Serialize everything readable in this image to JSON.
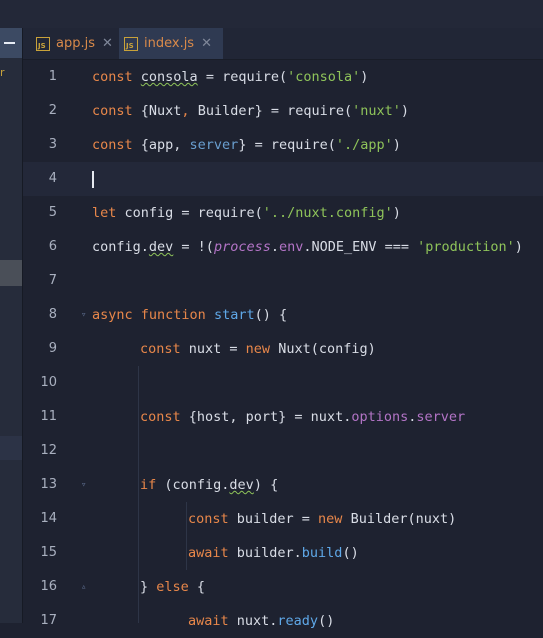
{
  "tabs": [
    {
      "label": "app.js",
      "icon": "js-file-icon",
      "active": false
    },
    {
      "label": "index.js",
      "icon": "js-file-icon",
      "active": true
    }
  ],
  "tab_close_glyph": "✕",
  "sidebar": {
    "letter": "r"
  },
  "editor": {
    "current_line": 4,
    "lines": [
      {
        "n": "1"
      },
      {
        "n": "2"
      },
      {
        "n": "3"
      },
      {
        "n": "4"
      },
      {
        "n": "5"
      },
      {
        "n": "6"
      },
      {
        "n": "7"
      },
      {
        "n": "8"
      },
      {
        "n": "9"
      },
      {
        "n": "10"
      },
      {
        "n": "11"
      },
      {
        "n": "12"
      },
      {
        "n": "13"
      },
      {
        "n": "14"
      },
      {
        "n": "15"
      },
      {
        "n": "16"
      },
      {
        "n": "17"
      }
    ],
    "tokens": {
      "l1": [
        "const",
        " ",
        "consola",
        " = ",
        "require",
        "(",
        "'consola'",
        ")"
      ],
      "l2": [
        "const",
        " {Nuxt",
        ", ",
        "Builder} = ",
        "require",
        "(",
        "'nuxt'",
        ")"
      ],
      "l3": [
        "const",
        " {app, ",
        "server",
        "} = ",
        "require",
        "(",
        "'./app'",
        ")"
      ],
      "l5": [
        "let",
        " config = ",
        "require",
        "(",
        "'../nuxt.config'",
        ")"
      ],
      "l6": [
        "config.",
        "dev",
        " = !(",
        "process",
        ".",
        "env",
        ".NODE_ENV === ",
        "'production'",
        ")"
      ],
      "l8": [
        "async",
        " ",
        "function",
        " ",
        "start",
        "() {"
      ],
      "l9": [
        "const",
        " nuxt = ",
        "new",
        " Nuxt(config)"
      ],
      "l11": [
        "const",
        " {host, port} = nuxt.",
        "options",
        ".",
        "server"
      ],
      "l13": [
        "if",
        " (config.",
        "dev",
        ") {"
      ],
      "l14": [
        "const",
        " builder = ",
        "new",
        " Builder(nuxt)"
      ],
      "l15": [
        "await",
        " builder.",
        "build",
        "()"
      ],
      "l16": [
        "} ",
        "else",
        " {"
      ],
      "l17": [
        "await",
        " nuxt.",
        "ready",
        "()"
      ]
    }
  },
  "colors": {
    "keyword": "#e8874a",
    "string": "#8fc45a",
    "function": "#5fa8e8",
    "property": "#b374c6",
    "background": "#1e2230"
  }
}
